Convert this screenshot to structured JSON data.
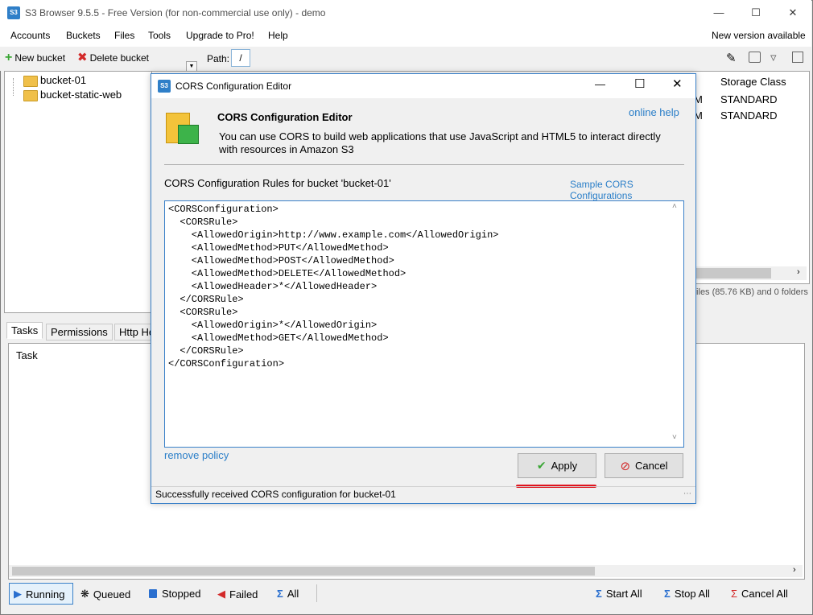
{
  "window": {
    "title": "S3 Browser 9.5.5 - Free Version (for non-commercial use only) - demo",
    "app_icon_text": "S3"
  },
  "menu": {
    "items": [
      "Accounts",
      "Buckets",
      "Files",
      "Tools",
      "Upgrade to Pro!",
      "Help"
    ],
    "right_notice": "New version available"
  },
  "toolbar": {
    "new_bucket": "New bucket",
    "delete_bucket": "Delete bucket",
    "path_label": "Path:",
    "path_value": "/"
  },
  "tree": {
    "buckets": [
      "bucket-01",
      "bucket-static-web"
    ]
  },
  "files_panel": {
    "column_storage_class": "Storage Class",
    "rows": [
      {
        "frag": "M",
        "storage": "STANDARD"
      },
      {
        "frag": "M",
        "storage": "STANDARD"
      }
    ],
    "summary_fragment": "files (85.76 KB) and 0 folders"
  },
  "bottom_tabs": {
    "tasks": "Tasks",
    "permissions": "Permissions",
    "http_headers": "Http He",
    "task_column": "Task"
  },
  "status_bar": {
    "running": "Running",
    "queued": "Queued",
    "stopped": "Stopped",
    "failed": "Failed",
    "all": "All",
    "start_all": "Start All",
    "stop_all": "Stop All",
    "cancel_all": "Cancel All"
  },
  "dialog": {
    "title": "CORS Configuration Editor",
    "header_title": "CORS Configuration Editor",
    "online_help": "online help",
    "description_line1": "You can use CORS to build web applications that use JavaScript and HTML5 to interact directly",
    "description_line2": "with resources in Amazon S3",
    "rules_label": "CORS Configuration Rules for bucket 'bucket-01'",
    "sample_link": "Sample CORS Configurations",
    "xml": "<CORSConfiguration>\n  <CORSRule>\n    <AllowedOrigin>http://www.example.com</AllowedOrigin>\n    <AllowedMethod>PUT</AllowedMethod>\n    <AllowedMethod>POST</AllowedMethod>\n    <AllowedMethod>DELETE</AllowedMethod>\n    <AllowedHeader>*</AllowedHeader>\n  </CORSRule>\n  <CORSRule>\n    <AllowedOrigin>*</AllowedOrigin>\n    <AllowedMethod>GET</AllowedMethod>\n  </CORSRule>\n</CORSConfiguration>",
    "remove_policy": "remove policy",
    "apply": "Apply",
    "cancel": "Cancel",
    "status": "Successfully received CORS configuration for bucket-01"
  },
  "colors": {
    "accent": "#3a80c8",
    "highlight_underline": "#e0141e",
    "link": "#2a7ec8"
  }
}
